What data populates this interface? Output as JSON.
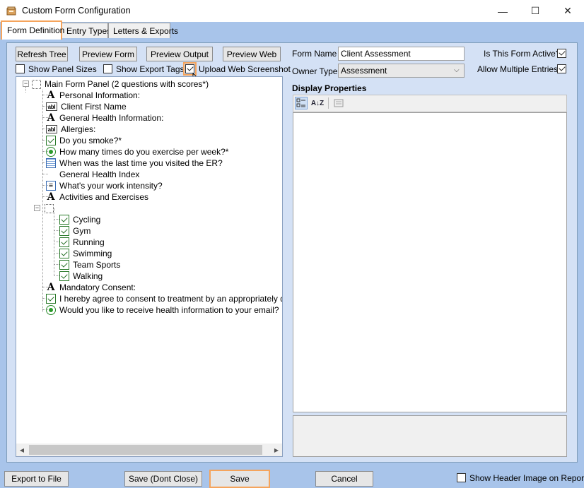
{
  "window": {
    "title": "Custom Form Configuration",
    "minimize": "—",
    "maximize": "☐",
    "close": "✕"
  },
  "tabs": [
    "Form Definition",
    "Entry Types",
    "Letters & Exports"
  ],
  "toolbar": {
    "refresh_tree": "Refresh Tree",
    "preview_form": "Preview Form",
    "preview_output": "Preview Output",
    "preview_web": "Preview Web"
  },
  "options": {
    "show_panel_sizes": "Show Panel Sizes",
    "show_export_tags": "Show Export Tags",
    "upload_web_screenshot": "Upload Web Screenshot"
  },
  "form": {
    "name_label": "Form Name",
    "name_value": "Client Assessment",
    "owner_label": "Owner Type",
    "owner_value": "Assessment",
    "active_label": "Is This Form Active?",
    "multiple_label": "Allow Multiple Entries?"
  },
  "display_properties": {
    "title": "Display Properties",
    "sort_alpha": "A↓Z"
  },
  "tree": {
    "root": "Main Form Panel (2 questions with scores*)",
    "items": [
      "Personal Information:",
      "Client First Name",
      "General Health Information:",
      "Allergies:",
      "Do you smoke?*",
      "How many times do you exercise per week?*",
      "When was the last time you visited the ER?",
      "General Health Index",
      "What's your work intensity?",
      "Activities and Exercises",
      "Cycling",
      "Gym",
      "Running",
      "Swimming",
      "Team Sports",
      "Walking",
      "Mandatory Consent:",
      "I hereby agree to consent to treatment by an appropriately qualified",
      "Would you like to receive health information to your email?"
    ],
    "icon_labels": {
      "A": "A",
      "abl": "abl"
    },
    "scroll_left": "◀",
    "scroll_right": "▶"
  },
  "bottom": {
    "export_to_file": "Export to File",
    "save_dont_close": "Save (Dont Close)",
    "save": "Save",
    "cancel": "Cancel",
    "show_header_image": "Show Header Image on Report?"
  },
  "colors": {
    "frame": "#a8c4ea",
    "content": "#d4e1f5",
    "highlight": "#f5a45c"
  }
}
